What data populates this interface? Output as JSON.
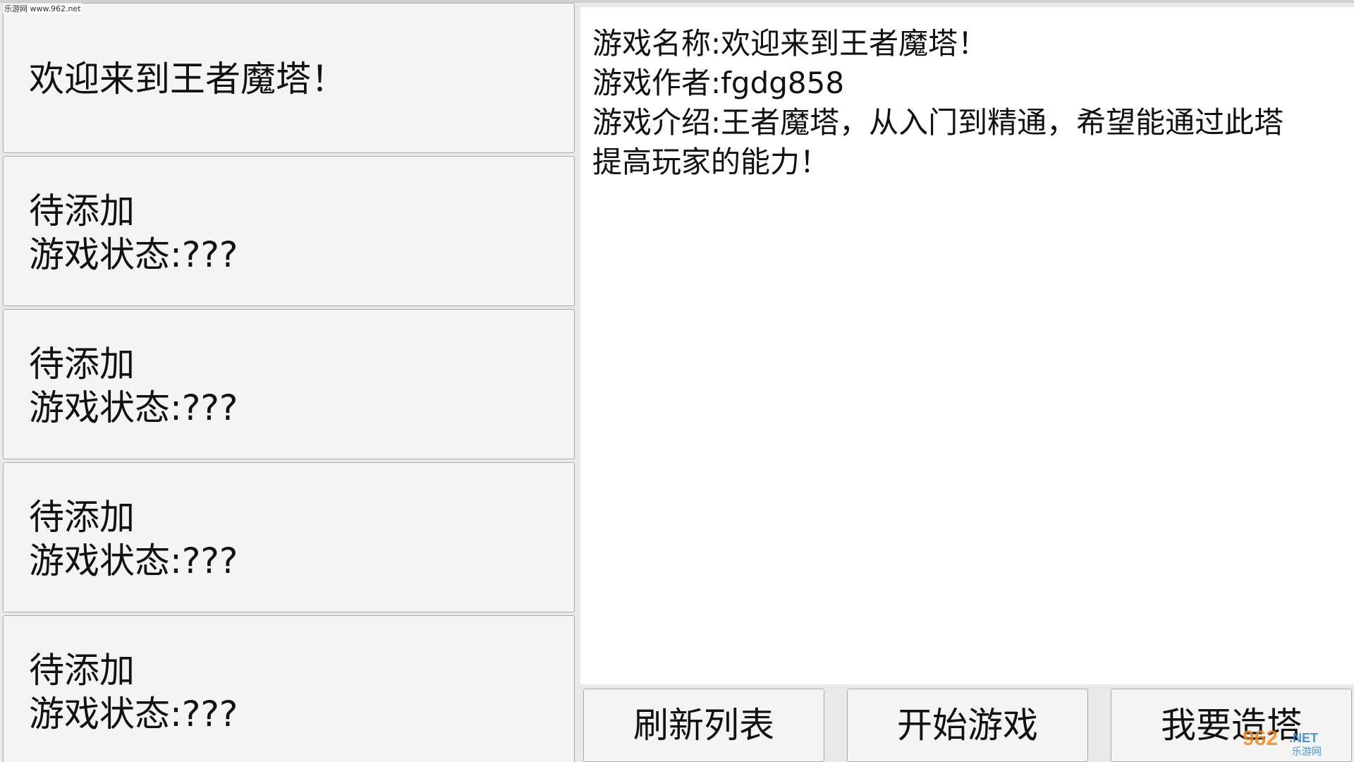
{
  "watermark": {
    "top_text": "乐游网 www.962.net",
    "corner_text": "962",
    "corner_suffix": ".NET",
    "corner_sub": "乐游网"
  },
  "game_list": [
    {
      "lines": [
        "欢迎来到王者魔塔！"
      ]
    },
    {
      "lines": [
        "待添加",
        "游戏状态:???"
      ]
    },
    {
      "lines": [
        "待添加",
        "游戏状态:???"
      ]
    },
    {
      "lines": [
        "待添加",
        "游戏状态:???"
      ]
    },
    {
      "lines": [
        "待添加",
        "游戏状态:???"
      ]
    }
  ],
  "detail": {
    "name": "游戏名称:欢迎来到王者魔塔！",
    "author": "游戏作者:fgdg858",
    "intro_line1": "游戏介绍:王者魔塔，从入门到精通，希望能通过此塔",
    "intro_line2": "提高玩家的能力！"
  },
  "buttons": {
    "refresh": "刷新列表",
    "start": "开始游戏",
    "build": "我要造塔"
  },
  "colors": {
    "panel_bg": "#f4f4f4",
    "detail_bg": "#ffffff",
    "border": "#a9a9a9",
    "watermark_orange": "#f08a1c",
    "watermark_blue": "#2a8ad8"
  }
}
